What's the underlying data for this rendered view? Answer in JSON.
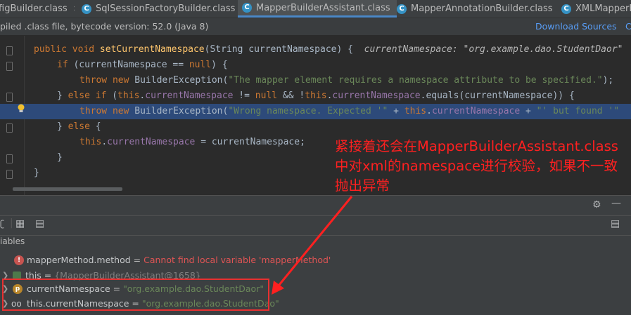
{
  "tabs": [
    {
      "label": "figBuilder.class",
      "icon": "class-icon",
      "active": false
    },
    {
      "label": "SqlSessionFactoryBuilder.class",
      "icon": "class-icon",
      "active": false
    },
    {
      "label": "MapperBuilderAssistant.class",
      "icon": "class-icon",
      "active": true
    },
    {
      "label": "MapperAnnotationBuilder.class",
      "icon": "class-icon",
      "active": false
    },
    {
      "label": "XMLMapperB",
      "icon": "class-icon",
      "active": false
    }
  ],
  "banner": {
    "message": "piled .class file, bytecode version: 52.0 (Java 8)",
    "download_sources": "Download Sources",
    "choose_sources": "C"
  },
  "code": {
    "l1_pre": "    ",
    "l1_kw": "public void ",
    "l1_fn": "setCurrentNamespace",
    "l1_rest": "(String currentNamespace) {",
    "l1_hint": "currentNamespace: \"org.example.dao.StudentDaor\"",
    "l2_kw": "if ",
    "l2_rest1": "(currentNamespace == ",
    "l2_null": "null",
    "l2_rest2": ") {",
    "l3_kw": "throw new ",
    "l3_cls": "BuilderException(",
    "l3_str": "\"The mapper element requires a namespace attribute to be specified.\"",
    "l3_end": ");",
    "l4_a": "} ",
    "l4_kw": "else if ",
    "l4_b": "(",
    "l4_this1": "this",
    "l4_c": ".",
    "l4_fld1": "currentNamespace",
    "l4_d": " != ",
    "l4_null": "null",
    "l4_e": " && !",
    "l4_this2": "this",
    "l4_f": ".",
    "l4_fld2": "currentNamespace",
    "l4_g": ".equals(currentNamespace)) {",
    "l5_kw": "throw new ",
    "l5_cls": "BuilderException(",
    "l5_str1": "\"Wrong namespace. Expected '\"",
    "l5_plus1": " + ",
    "l5_this": "this",
    "l5_dot": ".",
    "l5_fld": "currentNamespace",
    "l5_plus2": " + ",
    "l5_str2": "\"' but found '\"",
    "l6_a": "} ",
    "l6_kw": "else",
    "l6_b": " {",
    "l7_this": "this",
    "l7_dot": ".",
    "l7_fld": "currentNamespace",
    "l7_rest": " = currentNamespace;",
    "l8": "}",
    "l9": "}"
  },
  "debug": {
    "variables_header": "iables",
    "rows": [
      {
        "name": "mapperMethod.method",
        "eq": " = ",
        "value": "Cannot find local variable 'mapperMethod'",
        "kind": "error",
        "icon": "error-icon"
      },
      {
        "name": "this",
        "eq": " = ",
        "value": "{MapperBuilderAssistant@1658}",
        "kind": "object",
        "icon": "object-icon"
      },
      {
        "name": "currentNamespace",
        "eq": " = ",
        "value": "\"org.example.dao.StudentDaor\"",
        "kind": "param",
        "icon": "parameter-icon",
        "icon_text": "p"
      },
      {
        "name": "this.currentNamespace",
        "eq": " = ",
        "value": "\"org.example.dao.StudentDao\"",
        "kind": "watch",
        "icon": "watch-glasses-icon"
      }
    ]
  },
  "annotation": {
    "line1": "紧接着还会在MapperBuilderAssistant.class",
    "line2": "中对xml的namespace进行校验，如果不一致",
    "line3": "抛出异常",
    "color": "#ff2020"
  }
}
